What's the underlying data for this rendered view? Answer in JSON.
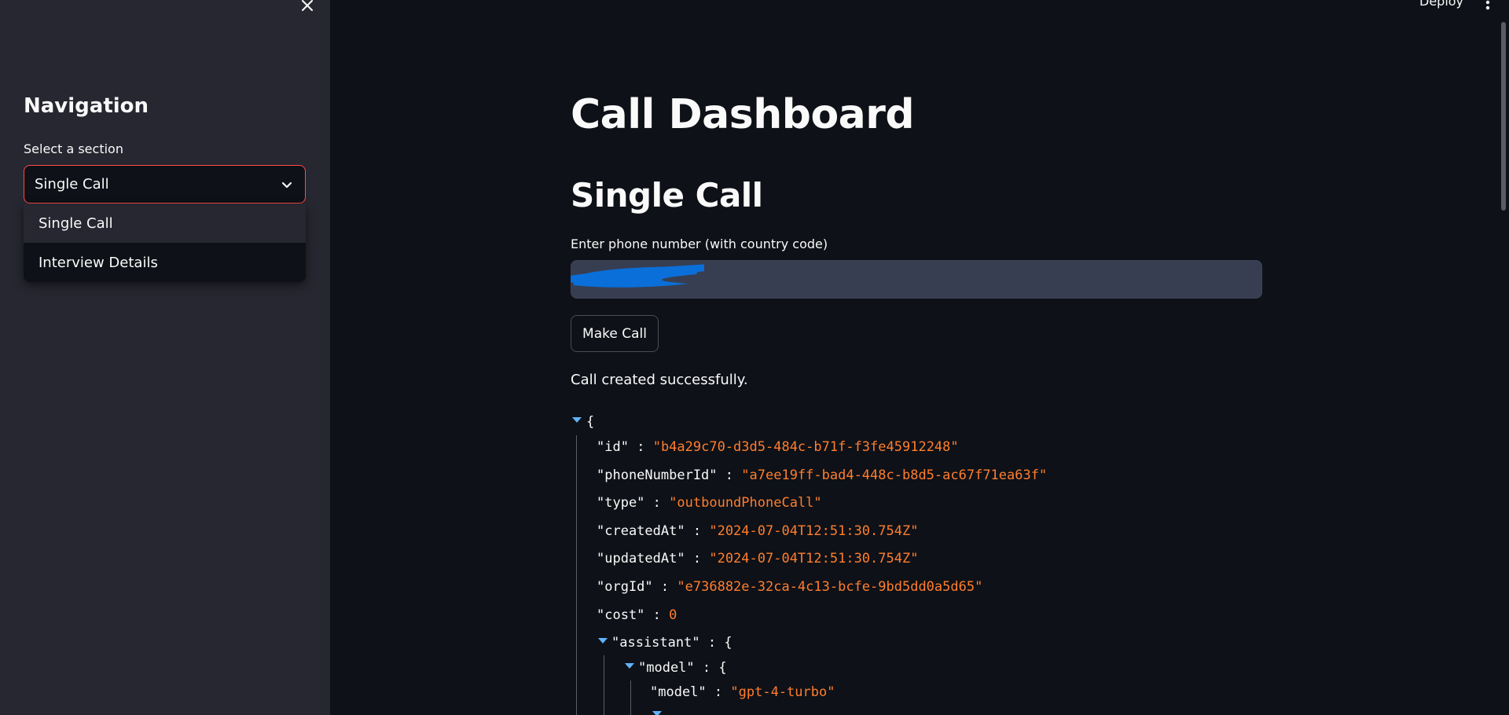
{
  "sidebar": {
    "title": "Navigation",
    "select_label": "Select a section",
    "select_value": "Single Call",
    "options": [
      {
        "label": "Single Call"
      },
      {
        "label": "Interview Details"
      }
    ]
  },
  "header": {
    "deploy_label": "Deploy"
  },
  "main": {
    "title": "Call Dashboard",
    "section_title": "Single Call",
    "phone_label": "Enter phone number (with country code)",
    "phone_value": "",
    "make_call_label": "Make Call",
    "status": "Call created successfully."
  },
  "json_viewer": {
    "open_brace": "{",
    "fields": {
      "id": {
        "key": "\"id\"",
        "value": "\"b4a29c70-d3d5-484c-b71f-f3fe45912248\""
      },
      "phoneNumberId": {
        "key": "\"phoneNumberId\"",
        "value": "\"a7ee19ff-bad4-448c-b8d5-ac67f71ea63f\""
      },
      "type": {
        "key": "\"type\"",
        "value": "\"outboundPhoneCall\""
      },
      "createdAt": {
        "key": "\"createdAt\"",
        "value": "\"2024-07-04T12:51:30.754Z\""
      },
      "updatedAt": {
        "key": "\"updatedAt\"",
        "value": "\"2024-07-04T12:51:30.754Z\""
      },
      "orgId": {
        "key": "\"orgId\"",
        "value": "\"e736882e-32ca-4c13-bcfe-9bd5dd0a5d65\""
      },
      "cost": {
        "key": "\"cost\"",
        "value": "0"
      },
      "assistant": {
        "key": "\"assistant\"",
        "value": "{"
      },
      "model_obj": {
        "key": "\"model\"",
        "value": "{"
      },
      "model_name": {
        "key": "\"model\"",
        "value": "\"gpt-4-turbo\""
      }
    },
    "separator": ":"
  },
  "colors": {
    "accent": "#ff4b4b",
    "json_value": "#ff7e2e",
    "json_toggle": "#5fb3ff",
    "sidebar_bg": "#262730",
    "main_bg": "#0e1117"
  },
  "icons": {
    "close": "close-icon",
    "chevron": "chevron-down-icon",
    "menu": "kebab-menu-icon",
    "toggle": "triangle-down-icon"
  }
}
